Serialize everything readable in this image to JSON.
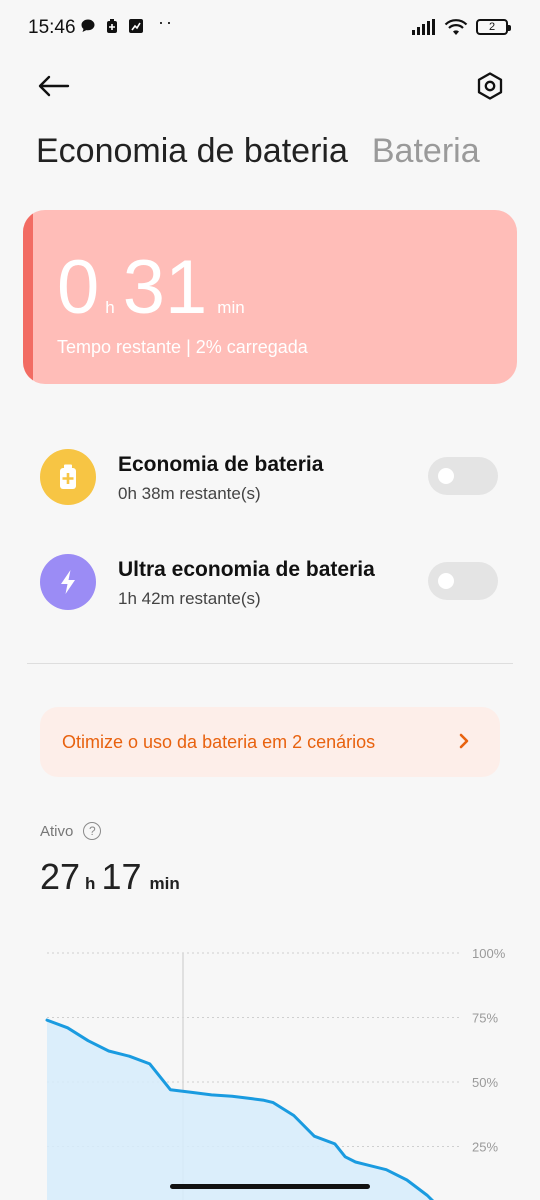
{
  "status_bar": {
    "time": "15:46",
    "dots": "··",
    "battery_level": "2"
  },
  "header": {
    "back_icon": "arrow-left-icon",
    "settings_icon": "hexagon-settings-icon"
  },
  "tabs": [
    {
      "label": "Economia de bateria",
      "active": true
    },
    {
      "label": "Bateria",
      "active": false
    }
  ],
  "battery_card": {
    "hours": "0",
    "hours_unit": "h",
    "minutes": "31",
    "minutes_unit": "min",
    "subtitle": "Tempo restante | 2% carregada",
    "bg_color": "#ffbdb8",
    "accent_color": "#f26c63"
  },
  "modes": [
    {
      "title": "Economia de bateria",
      "subtitle": "0h 38m restante(s)",
      "icon": "battery-plus-icon",
      "icon_color": "#f7c544",
      "enabled": false
    },
    {
      "title": "Ultra economia de bateria",
      "subtitle": "1h 42m restante(s)",
      "icon": "lightning-icon",
      "icon_color": "#9b8cf5",
      "enabled": false
    }
  ],
  "optimize_banner": {
    "text": "Otimize o uso da bateria em 2 cenários",
    "color": "#e8620f"
  },
  "active": {
    "label": "Ativo",
    "help_icon": "?",
    "hours": "27",
    "hours_unit": "h",
    "minutes": "17",
    "minutes_unit": "min"
  },
  "chart_data": {
    "type": "area",
    "y_ticks": [
      "100%",
      "75%",
      "50%",
      "25%"
    ],
    "ylim": [
      0,
      100
    ],
    "x": [
      0,
      2,
      4,
      6,
      8,
      10,
      12,
      14,
      16,
      18,
      19,
      20,
      21,
      22,
      24,
      26,
      28,
      29,
      30,
      31,
      33,
      35,
      37,
      38,
      39
    ],
    "values": [
      74,
      71,
      66,
      62,
      60,
      57,
      47,
      46,
      45,
      44.5,
      44,
      43.5,
      43,
      42,
      37,
      29,
      26,
      21,
      19,
      18,
      16,
      12,
      6,
      2,
      0
    ],
    "line_color": "#1a9be0",
    "fill_color": "#d6ecfb"
  }
}
